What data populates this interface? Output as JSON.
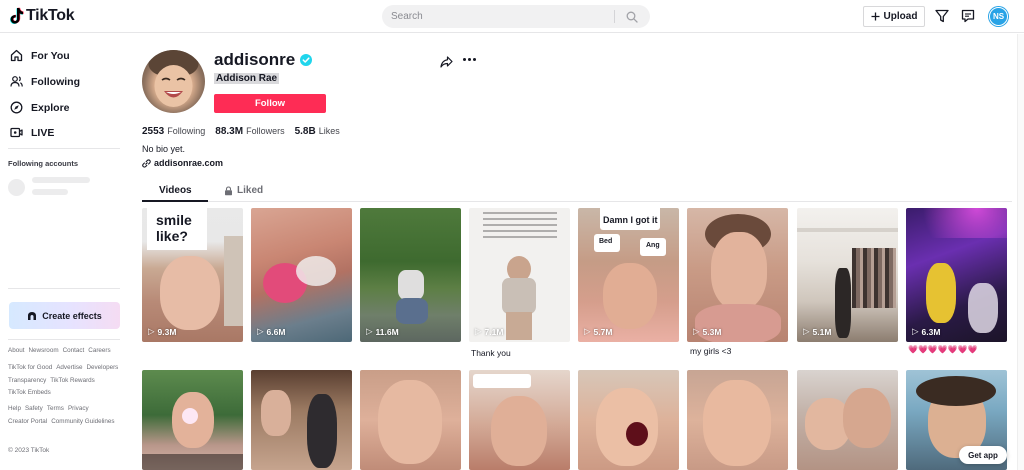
{
  "header": {
    "logo_text": "TikTok",
    "search_placeholder": "Search",
    "upload_label": "Upload",
    "user_initials": "NS"
  },
  "sidebar": {
    "nav": [
      {
        "label": "For You",
        "icon": "home-icon"
      },
      {
        "label": "Following",
        "icon": "people-icon"
      },
      {
        "label": "Explore",
        "icon": "compass-icon"
      },
      {
        "label": "LIVE",
        "icon": "live-icon"
      }
    ],
    "following_heading": "Following accounts",
    "create_effects_label": "Create effects",
    "footer_links_1": [
      "About",
      "Newsroom",
      "Contact",
      "Careers"
    ],
    "footer_links_2": [
      "TikTok for Good",
      "Advertise",
      "Developers",
      "Transparency",
      "TikTok Rewards",
      "TikTok Embeds"
    ],
    "footer_links_3": [
      "Help",
      "Safety",
      "Terms",
      "Privacy",
      "Creator Portal",
      "Community Guidelines"
    ],
    "copyright": "© 2023 TikTok"
  },
  "profile": {
    "username": "addisonre",
    "display_name": "Addison Rae",
    "follow_label": "Follow",
    "following_count": "2553",
    "following_label": "Following",
    "followers_count": "88.3M",
    "followers_label": "Followers",
    "likes_count": "5.8B",
    "likes_label": "Likes",
    "bio": "No bio yet.",
    "link": "addisonrae.com"
  },
  "tabs": {
    "videos": "Videos",
    "liked": "Liked"
  },
  "videos_row1": [
    {
      "views": "9.3M",
      "caption": "",
      "overlay": "smile like?"
    },
    {
      "views": "6.6M",
      "caption": ""
    },
    {
      "views": "11.6M",
      "caption": ""
    },
    {
      "views": "7.1M",
      "caption": "Thank you"
    },
    {
      "views": "5.7M",
      "caption": "",
      "overlay": "Damn I got it",
      "opt_a": "Bed",
      "opt_b": "Ang"
    },
    {
      "views": "5.3M",
      "caption": "my girls <3"
    },
    {
      "views": "5.1M",
      "caption": ""
    },
    {
      "views": "6.3M",
      "caption": "💗💗💗💗💗💗💗"
    }
  ],
  "get_app_label": "Get app",
  "colors": {
    "accent": "#fe2c55",
    "verified": "#20d5ec",
    "text": "#161823"
  }
}
